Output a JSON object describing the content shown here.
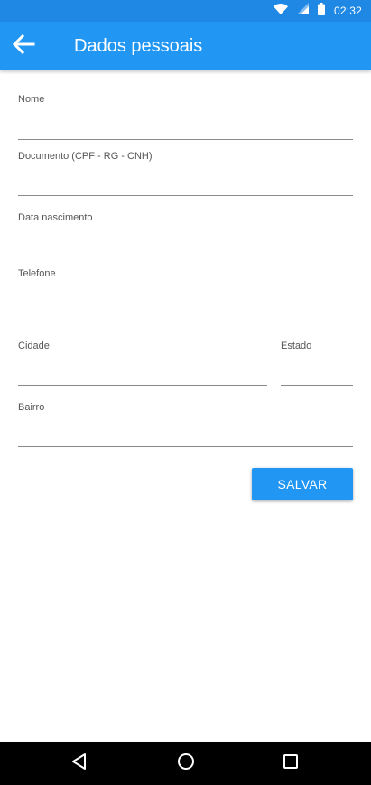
{
  "status_bar": {
    "time": "02:32",
    "icons": [
      "wifi-icon",
      "signal-icon",
      "battery-icon"
    ]
  },
  "app_bar": {
    "title": "Dados pessoais",
    "back_icon": "arrow-left-icon"
  },
  "form": {
    "nome_label": "Nome",
    "nome_value": "",
    "documento_label": "Documento (CPF - RG - CNH)",
    "documento_value": "",
    "data_label": "Data nascimento",
    "data_value": "",
    "telefone_label": "Telefone",
    "telefone_value": "",
    "cidade_label": "Cidade",
    "cidade_value": "",
    "estado_label": "Estado",
    "estado_value": "",
    "bairro_label": "Bairro",
    "bairro_value": ""
  },
  "actions": {
    "save_label": "SALVAR"
  },
  "nav_bar": {
    "icons": [
      "back-triangle-icon",
      "home-circle-icon",
      "recents-square-icon"
    ]
  },
  "colors": {
    "status_bar": "#1f88e5",
    "app_bar": "#2196f3",
    "button": "#2196f3",
    "nav_bar": "#000000"
  }
}
